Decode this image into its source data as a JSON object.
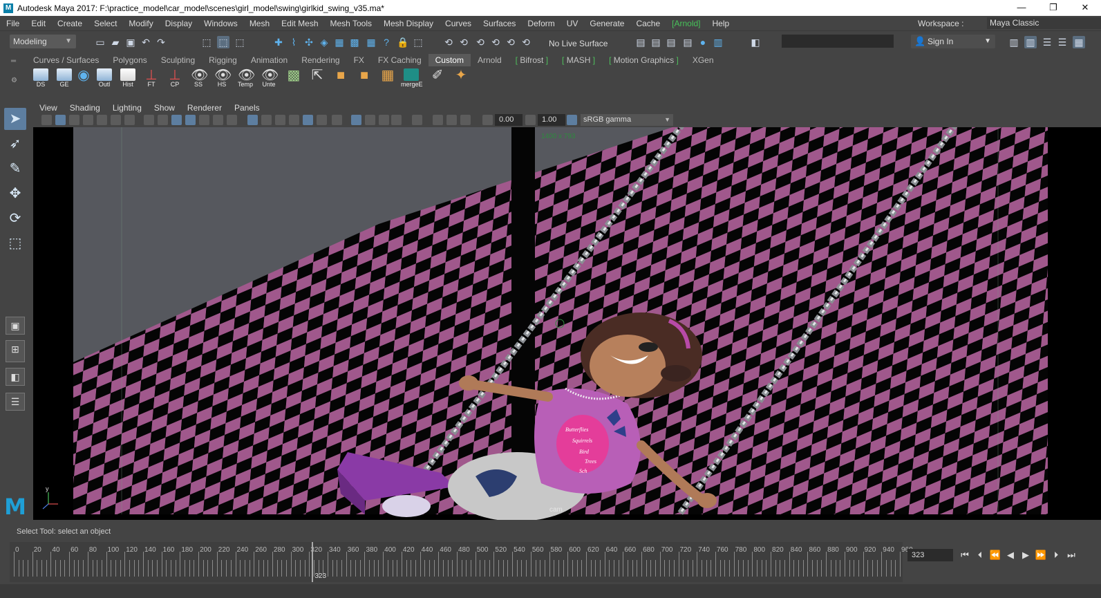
{
  "window": {
    "title": "Autodesk Maya 2017: F:\\practice_model\\car_model\\scenes\\girl_model\\swing\\girlkid_swing_v35.ma*",
    "logo_letter": "M",
    "minimize": "—",
    "restore": "❐",
    "close": "✕"
  },
  "menubar": {
    "items": [
      "File",
      "Edit",
      "Create",
      "Select",
      "Modify",
      "Display",
      "Windows",
      "Mesh",
      "Edit Mesh",
      "Mesh Tools",
      "Mesh Display",
      "Curves",
      "Surfaces",
      "Deform",
      "UV",
      "Generate",
      "Cache",
      "[Arnold]",
      "Help"
    ],
    "workspace_label": "Workspace :",
    "workspace_value": "Maya Classic"
  },
  "statusline": {
    "menuset": "Modeling",
    "live_surface": "No Live Surface",
    "signin": "Sign In"
  },
  "shelf": {
    "tabs": [
      "Curves / Surfaces",
      "Polygons",
      "Sculpting",
      "Rigging",
      "Animation",
      "Rendering",
      "FX",
      "FX Caching",
      "Custom",
      "Arnold",
      "Bifrost",
      "MASH",
      "Motion Graphics",
      "XGen"
    ],
    "active_tab": "Custom",
    "buttons": [
      "DS",
      "GE",
      "",
      "Outl",
      "Hist",
      "FT",
      "CP",
      "SS",
      "HS",
      "Temp",
      "Unte",
      "",
      "",
      "",
      "",
      "",
      "mergeE",
      "",
      ""
    ]
  },
  "panel": {
    "menus": [
      "View",
      "Shading",
      "Lighting",
      "Show",
      "Renderer",
      "Panels"
    ],
    "exposure": "0.00",
    "gamma": "1.00",
    "colorspace": "sRGB gamma"
  },
  "viewport": {
    "resolution": "1400 x 793",
    "camera": "cam",
    "axis_y": "y",
    "checker_color": "#a0588c",
    "background_color": "#56585e",
    "shirt_print": [
      "Butterflies",
      "Squirrels",
      "Bird",
      "Trees",
      "Sch"
    ]
  },
  "helpline": {
    "text": "Select Tool: select an object"
  },
  "timeline": {
    "start": 0,
    "end": 960,
    "tick_labels": [
      "0",
      "20",
      "40",
      "60",
      "80",
      "100",
      "120",
      "140",
      "160",
      "180",
      "200",
      "220",
      "240",
      "260",
      "280",
      "300",
      "320",
      "340",
      "360",
      "380",
      "400",
      "420",
      "440",
      "460",
      "480",
      "500",
      "520",
      "540",
      "560",
      "580",
      "600",
      "620",
      "640",
      "660",
      "680",
      "700",
      "720",
      "740",
      "760",
      "780",
      "800",
      "820",
      "840",
      "860",
      "880",
      "900",
      "920",
      "940",
      "960"
    ],
    "current_frame": "323",
    "frame_field": "323"
  }
}
